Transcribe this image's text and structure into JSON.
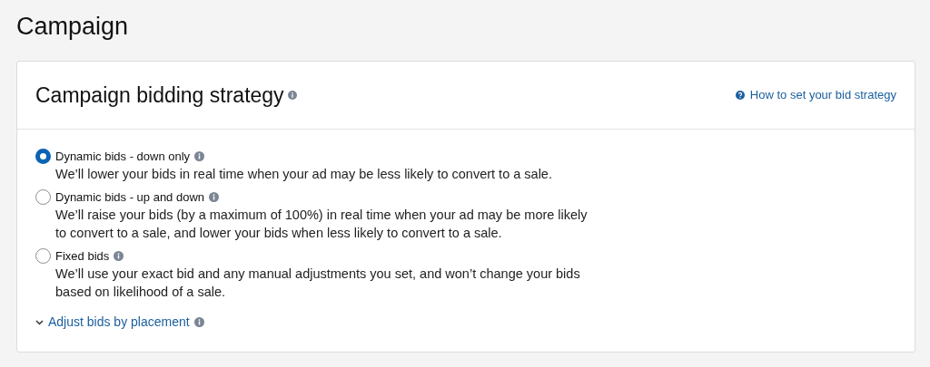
{
  "page_title": "Campaign",
  "card": {
    "title": "Campaign bidding strategy",
    "help_link": "How to set your bid strategy",
    "options": [
      {
        "label": "Dynamic bids - down only",
        "description": "We’ll lower your bids in real time when your ad may be less likely to convert to a sale.",
        "selected": true
      },
      {
        "label": "Dynamic bids - up and down",
        "description": "We’ll raise your bids (by a maximum of 100%) in real time when your ad may be more likely to convert to a sale, and lower your bids when less likely to convert to a sale.",
        "selected": false
      },
      {
        "label": "Fixed bids",
        "description": "We’ll use your exact bid and any manual adjustments you set, and won’t change your bids based on likelihood of a sale.",
        "selected": false
      }
    ],
    "expander": {
      "label": "Adjust bids by placement",
      "expanded": false
    }
  }
}
